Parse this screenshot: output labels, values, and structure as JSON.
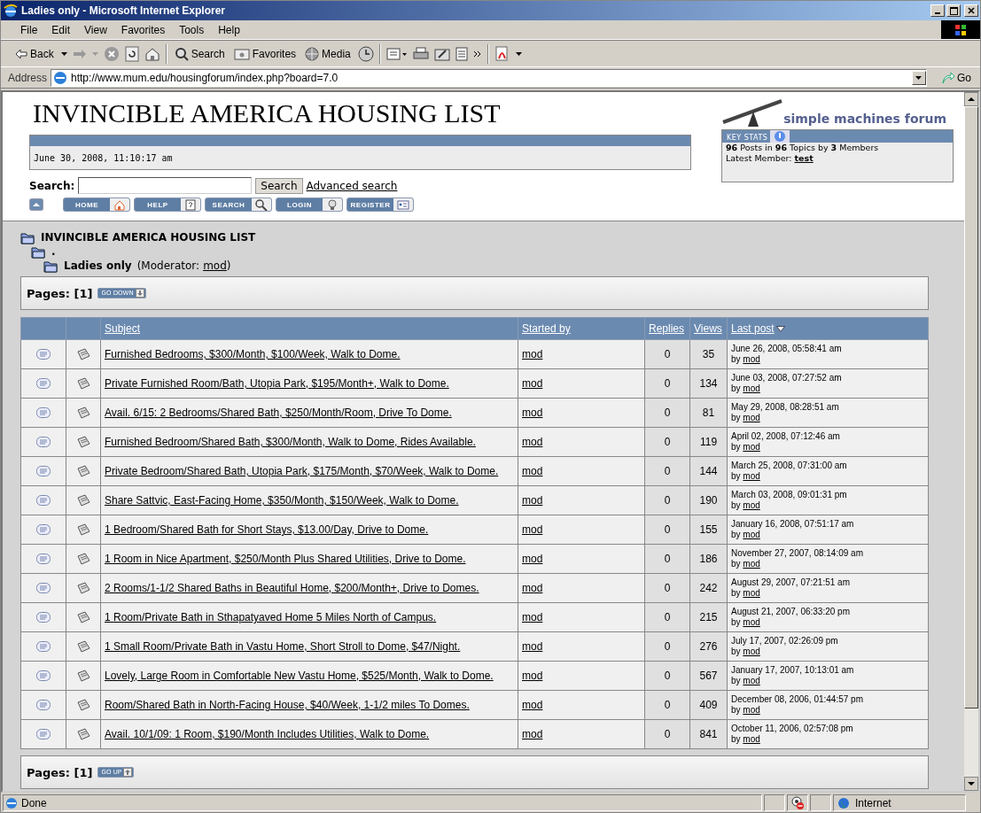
{
  "window": {
    "title": "Ladies only - Microsoft Internet Explorer"
  },
  "menu": [
    "File",
    "Edit",
    "View",
    "Favorites",
    "Tools",
    "Help"
  ],
  "toolbar": {
    "back": "Back",
    "search": "Search",
    "favorites": "Favorites",
    "media": "Media"
  },
  "address_bar": {
    "label": "Address",
    "url": "http://www.mum.edu/housingforum/index.php?board=7.0",
    "go": "Go"
  },
  "header": {
    "title": "INVINCIBLE AMERICA HOUSING LIST",
    "date": "June 30, 2008, 11:10:17 am",
    "logo_text": "simple machines forum"
  },
  "key_stats": {
    "tab": "KEY STATS",
    "summary": "**96** Posts in **96** Topics by **3** Members",
    "latest_label": "Latest Member:",
    "latest_member": "test"
  },
  "search": {
    "label": "Search:",
    "button": "Search",
    "advanced": "Advanced search"
  },
  "nav_buttons": [
    {
      "label": "HOME"
    },
    {
      "label": "HELP"
    },
    {
      "label": "SEARCH"
    },
    {
      "label": "LOGIN"
    },
    {
      "label": "REGISTER"
    }
  ],
  "breadcrumb": {
    "items": [
      {
        "label": "INVINCIBLE AMERICA HOUSING LIST",
        "children": [
          {
            "label": ".",
            "children": [
              {
                "label": "Ladies only"
              }
            ]
          }
        ]
      }
    ],
    "moderator_label": "(Moderator:",
    "moderator": "mod",
    "moderator_close": ")"
  },
  "pages_top": {
    "label": "Pages: [1]",
    "button": "GO DOWN"
  },
  "table": {
    "columns": [
      "Subject",
      "Started by",
      "Replies",
      "Views",
      "Last post"
    ],
    "rows": [
      {
        "subject": "Furnished Bedrooms, $300/Month, $100/Week, Walk to Dome.",
        "started_by": "mod",
        "replies": "0",
        "views": "35",
        "last_post": "June 26, 2008, 05:58:41 am",
        "by": "by",
        "last_by": "mod"
      },
      {
        "subject": "Private Furnished Room/Bath, Utopia Park, $195/Month+, Walk to Dome.",
        "started_by": "mod",
        "replies": "0",
        "views": "134",
        "last_post": "June 03, 2008, 07:27:52 am",
        "by": "by",
        "last_by": "mod"
      },
      {
        "subject": "Avail. 6/15: 2 Bedrooms/Shared Bath, $250/Month/Room, Drive To Dome.",
        "started_by": "mod",
        "replies": "0",
        "views": "81",
        "last_post": "May 29, 2008, 08:28:51 am",
        "by": "by",
        "last_by": "mod"
      },
      {
        "subject": "Furnished Bedroom/Shared Bath, $300/Month, Walk to Dome, Rides Available.",
        "started_by": "mod",
        "replies": "0",
        "views": "119",
        "last_post": "April 02, 2008, 07:12:46 am",
        "by": "by",
        "last_by": "mod"
      },
      {
        "subject": "Private Bedroom/Shared Bath, Utopia Park, $175/Month, $70/Week, Walk to Dome.",
        "started_by": "mod",
        "replies": "0",
        "views": "144",
        "last_post": "March 25, 2008, 07:31:00 am",
        "by": "by",
        "last_by": "mod"
      },
      {
        "subject": "Share Sattvic, East-Facing Home, $350/Month, $150/Week, Walk to Dome.",
        "started_by": "mod",
        "replies": "0",
        "views": "190",
        "last_post": "March 03, 2008, 09:01:31 pm",
        "by": "by",
        "last_by": "mod"
      },
      {
        "subject": "1 Bedroom/Shared Bath for Short Stays, $13.00/Day, Drive to Dome.",
        "started_by": "mod",
        "replies": "0",
        "views": "155",
        "last_post": "January 16, 2008, 07:51:17 am",
        "by": "by",
        "last_by": "mod"
      },
      {
        "subject": "1 Room in Nice Apartment, $250/Month Plus Shared Utilities, Drive to Dome.",
        "started_by": "mod",
        "replies": "0",
        "views": "186",
        "last_post": "November 27, 2007, 08:14:09 am",
        "by": "by",
        "last_by": "mod"
      },
      {
        "subject": "2 Rooms/1-1/2 Shared Baths in Beautiful Home, $200/Month+, Drive to Domes.",
        "started_by": "mod",
        "replies": "0",
        "views": "242",
        "last_post": "August 29, 2007, 07:21:51 am",
        "by": "by",
        "last_by": "mod"
      },
      {
        "subject": "1 Room/Private Bath in Sthapatyaved Home 5 Miles North of Campus.",
        "started_by": "mod",
        "replies": "0",
        "views": "215",
        "last_post": "August 21, 2007, 06:33:20 pm",
        "by": "by",
        "last_by": "mod"
      },
      {
        "subject": "1 Small Room/Private Bath in Vastu Home, Short Stroll to Dome, $47/Night.",
        "started_by": "mod",
        "replies": "0",
        "views": "276",
        "last_post": "July 17, 2007, 02:26:09 pm",
        "by": "by",
        "last_by": "mod"
      },
      {
        "subject": "Lovely, Large Room in Comfortable New Vastu Home, $525/Month, Walk to Dome.",
        "started_by": "mod",
        "replies": "0",
        "views": "567",
        "last_post": "January 17, 2007, 10:13:01 am",
        "by": "by",
        "last_by": "mod"
      },
      {
        "subject": "Room/Shared Bath in North-Facing House, $40/Week, 1-1/2 miles To Domes.",
        "started_by": "mod",
        "replies": "0",
        "views": "409",
        "last_post": "December 08, 2006, 01:44:57 pm",
        "by": "by",
        "last_by": "mod"
      },
      {
        "subject": "Avail. 10/1/09: 1 Room, $190/Month Includes Utilities, Walk to Dome.",
        "started_by": "mod",
        "replies": "0",
        "views": "841",
        "last_post": "October 11, 2006, 02:57:08 pm",
        "by": "by",
        "last_by": "mod"
      }
    ]
  },
  "pages_bottom": {
    "label": "Pages: [1]",
    "button": "GO UP"
  },
  "status_bar": {
    "text": "Done",
    "zone": "Internet"
  }
}
